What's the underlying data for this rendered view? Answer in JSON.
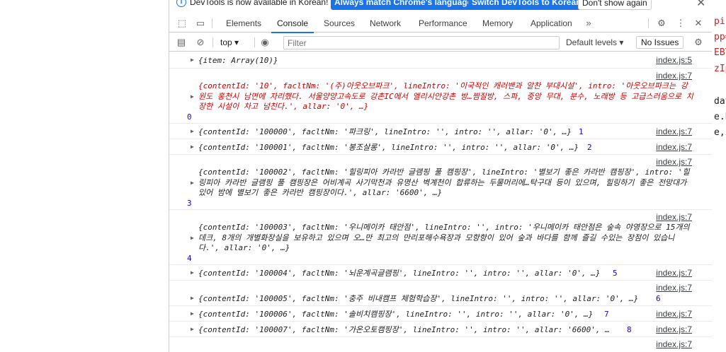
{
  "infobar": {
    "message": "DevTools is now available in Korean!",
    "btn_match": "Always match Chrome's language",
    "btn_switch": "Switch DevTools to Korean",
    "btn_dismiss": "Don't show again"
  },
  "tabs": [
    "Elements",
    "Console",
    "Sources",
    "Network",
    "Performance",
    "Memory",
    "Application"
  ],
  "active_tab": "Console",
  "toolbar": {
    "context": "top",
    "filter_placeholder": "Filter",
    "levels": "Default levels",
    "issues": "No Issues"
  },
  "page_right_code": [
    "pis",
    "pp=",
    "EBY",
    "zIp",
    "dat",
    "e.b",
    "e,i"
  ],
  "console": [
    {
      "src": "index.js:5",
      "text": "{item: Array(10)}"
    },
    {
      "src": "index.js:7",
      "text": "{contentId: '10', facltNm: '(주)아웃오브파크', lineIntro: '이국적인 캐러밴과 알찬 부대시설', intro: '아웃오브파크는 강원도 홍천시 남면에 자리했다. 서울양양고속도로 강촌IC에서 엘리시안강촌 방…찜질방, 스파, 중앙 무대, 분수, 노래방 등 고급스러움으로 치장한 시설이 차고 넘친다.', allar: '0', …}",
      "n": "0"
    },
    {
      "src": "index.js:7",
      "text": "{contentId: '100000', facltNm: '파크링', lineIntro: '', intro: '', allar: '0', …}",
      "n": "1"
    },
    {
      "src": "index.js:7",
      "text": "{contentId: '100001', facltNm: '봉조살롱', lineIntro: '', intro: '', allar: '0', …}",
      "n": "2"
    },
    {
      "src": "index.js:7",
      "text": "{contentId: '100002', facltNm: '힐링피아 카라반 글램핑 풀 캠핑장', lineIntro: '별보기 좋은 카라반 캠핑장', intro: '힐링피아 카라반 글램핑 풀 캠핑장은 어비계곡 사기막천과 유명산 벽계천이 합류하는 두물머리에…탁구대 등이 있으며, 힐링하기 좋은 전망대가 있어 밤에 별보기 좋은 카라반 캠핑장이다.', allar: '6600', …}",
      "n": "3"
    },
    {
      "src": "index.js:7",
      "text": "{contentId: '100003', facltNm: '우니메이카 태안점', lineIntro: '', intro: '우니메이카 태안점은 숲속 야영장으로 15개의 데크, 8개의 개별화장실을 보유하고 있으며 오…만 최고의 만리포해수욕장과 모항항이 있어 숲과 바다를 함께 즐길 수있는 장점이 있습니다.', allar: '0', …}",
      "n": "4"
    },
    {
      "src": "index.js:7",
      "text": "{contentId: '100004', facltNm: '뇌운계곡글램핑', lineIntro: '', intro: '', allar: '0', …}",
      "n": "5"
    },
    {
      "src": "index.js:7",
      "text": "{contentId: '100005', facltNm: '충주 비내캠프 체험학습장', lineIntro: '', intro: '', allar: '0', …}",
      "n": "6"
    },
    {
      "src": "index.js:7",
      "text": "{contentId: '100006', facltNm: '솔비치캠핑장', lineIntro: '', intro: '', allar: '0', …}",
      "n": "7"
    },
    {
      "src": "index.js:7",
      "text": "{contentId: '100007', facltNm: '가온오토캠핑장', lineIntro: '', intro: '', allar: '6600', …}",
      "n": "8"
    },
    {
      "src": "index.js:7",
      "text": ""
    }
  ]
}
